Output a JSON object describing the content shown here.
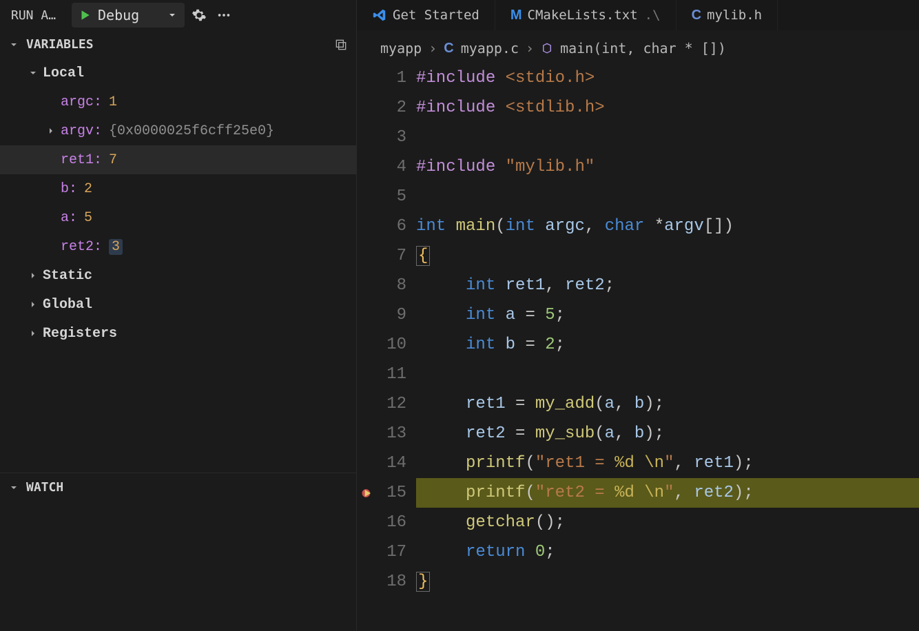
{
  "runbar": {
    "title": "RUN A...",
    "config": "Debug"
  },
  "panels": {
    "variables": "VARIABLES",
    "watch": "WATCH"
  },
  "scopes": {
    "local": "Local",
    "static": "Static",
    "global": "Global",
    "registers": "Registers"
  },
  "vars": {
    "argc": {
      "name": "argc:",
      "val": "1"
    },
    "argv": {
      "name": "argv:",
      "val": "{0x0000025f6cff25e0}"
    },
    "ret1": {
      "name": "ret1:",
      "val": "7"
    },
    "b": {
      "name": "b:",
      "val": "2"
    },
    "a": {
      "name": "a:",
      "val": "5"
    },
    "ret2": {
      "name": "ret2:",
      "val": "3"
    }
  },
  "tabs": {
    "getstarted": "Get Started",
    "cmake": "CMakeLists.txt",
    "cmake_suffix": ".\\",
    "mylib": "mylib.h"
  },
  "breadcrumb": {
    "folder": "myapp",
    "file": "myapp.c",
    "symbol": "main(int, char * [])"
  },
  "lineNumbers": [
    "1",
    "2",
    "3",
    "4",
    "5",
    "6",
    "7",
    "8",
    "9",
    "10",
    "11",
    "12",
    "13",
    "14",
    "15",
    "16",
    "17",
    "18"
  ],
  "code": {
    "l1_dir": "#include",
    "l1_hdr": "<stdio.h>",
    "l2_dir": "#include",
    "l2_hdr": "<stdlib.h>",
    "l4_dir": "#include",
    "l4_hdr": "\"mylib.h\"",
    "l6_int": "int",
    "l6_main": "main",
    "l6_argc_t": "int",
    "l6_argc": "argc",
    "l6_char": "char",
    "l6_argv": "argv",
    "l8_int": "int",
    "l8_ret1": "ret1",
    "l8_ret2": "ret2",
    "l9_int": "int",
    "l9_a": "a",
    "l9_5": "5",
    "l10_int": "int",
    "l10_b": "b",
    "l10_2": "2",
    "l12_ret1": "ret1",
    "l12_fn": "my_add",
    "l12_a": "a",
    "l12_b": "b",
    "l13_ret2": "ret2",
    "l13_fn": "my_sub",
    "l13_a": "a",
    "l13_b": "b",
    "l14_fn": "printf",
    "l14_s1": "\"ret1 = ",
    "l14_fmt": "%d",
    "l14_sp": " ",
    "l14_esc": "\\n",
    "l14_s2": "\"",
    "l14_ret1": "ret1",
    "l15_fn": "printf",
    "l15_s1": "\"ret2 = ",
    "l15_fmt": "%d",
    "l15_sp": " ",
    "l15_esc": "\\n",
    "l15_s2": "\"",
    "l15_ret2": "ret2",
    "l16_fn": "getchar",
    "l17_ret": "return",
    "l17_0": "0"
  }
}
